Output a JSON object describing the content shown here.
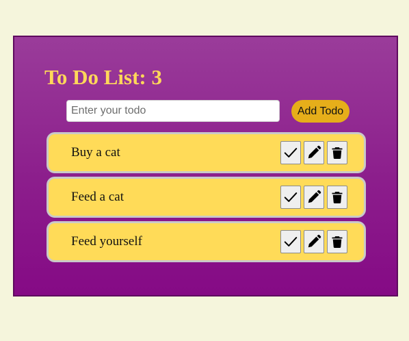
{
  "app": {
    "title": "To Do List: 3"
  },
  "form": {
    "input_value": "",
    "input_placeholder": "Enter your todo",
    "add_label": "Add Todo"
  },
  "todos": [
    {
      "text": "Buy a cat"
    },
    {
      "text": "Feed a cat"
    },
    {
      "text": "Feed yourself"
    }
  ],
  "icons": {
    "complete": "check-icon",
    "edit": "pencil-icon",
    "delete": "trash-icon"
  },
  "colors": {
    "page_background": "#f5f5dc",
    "panel_background": "#8c1e8c",
    "title": "#ffd75a",
    "item_background": "#ffdb58",
    "add_button": "#e6ae1a"
  }
}
